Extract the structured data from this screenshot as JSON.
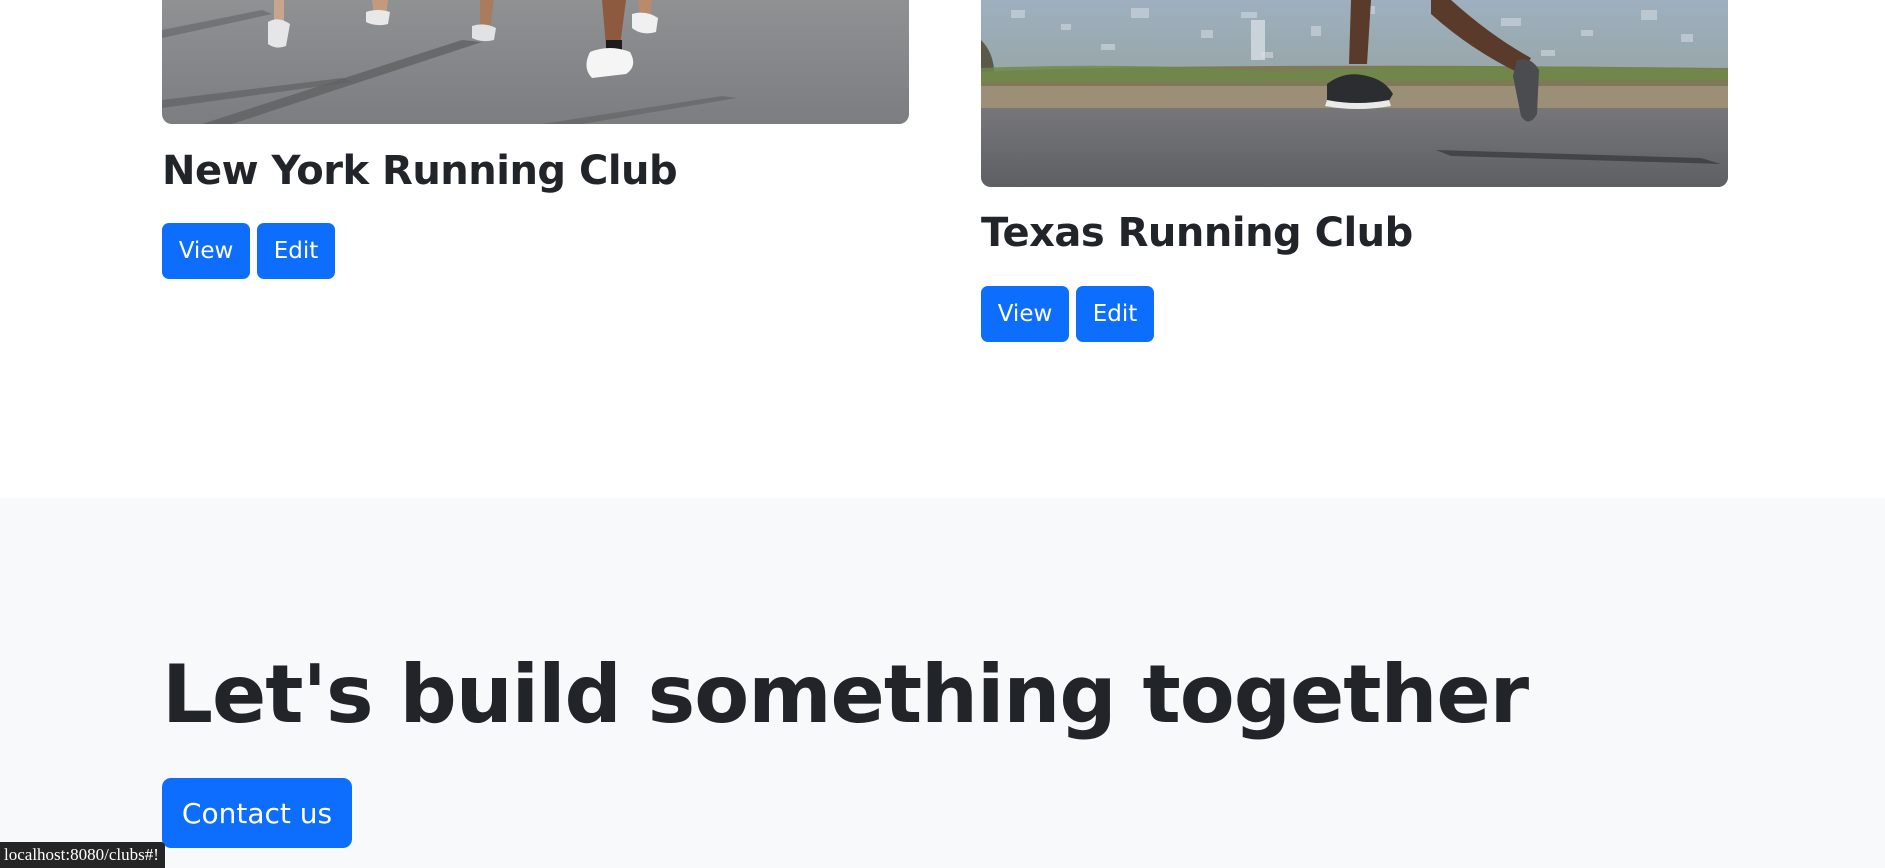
{
  "clubs": [
    {
      "title": "New York Running Club",
      "image_icon": "runners-image",
      "view_label": "View",
      "edit_label": "Edit"
    },
    {
      "title": "Texas Running Club",
      "image_icon": "runner-hill-image",
      "view_label": "View",
      "edit_label": "Edit"
    }
  ],
  "cta": {
    "heading": "Let's build something together",
    "button_label": "Contact us"
  },
  "status_bar": {
    "url": "localhost:8080/clubs#!"
  },
  "colors": {
    "primary": "#0d6efd",
    "text": "#212529",
    "section_bg": "#f8f9fa",
    "status_bg": "#252525"
  }
}
